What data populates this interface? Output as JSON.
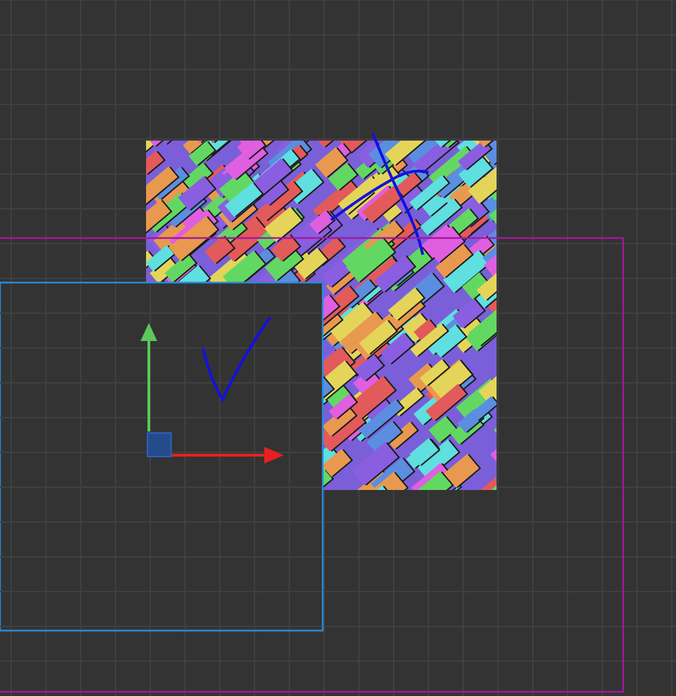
{
  "viewport": {
    "kind": "canvas-2d"
  }
}
